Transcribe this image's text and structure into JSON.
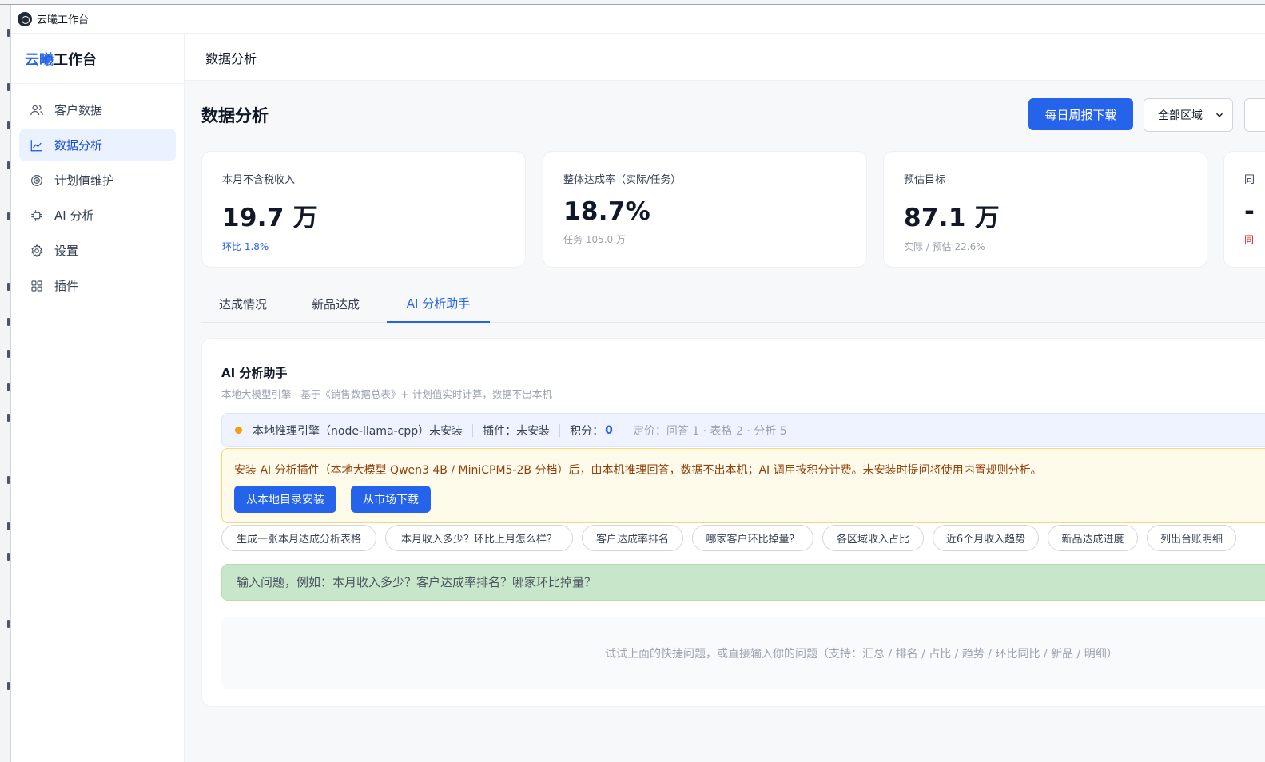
{
  "window": {
    "title": "云曦工作台"
  },
  "brand": {
    "part1": "云曦",
    "part2": "工作台"
  },
  "sidebar": {
    "items": [
      {
        "label": "客户数据",
        "icon": "users-icon"
      },
      {
        "label": "数据分析",
        "icon": "line-chart-icon",
        "active": true
      },
      {
        "label": "计划值维护",
        "icon": "target-icon"
      },
      {
        "label": "AI 分析",
        "icon": "chip-icon"
      },
      {
        "label": "设置",
        "icon": "gear-icon"
      },
      {
        "label": "插件",
        "icon": "grid-icon"
      }
    ]
  },
  "topbar": {
    "title": "数据分析"
  },
  "page": {
    "title": "数据分析",
    "download_button": "每日周报下载",
    "region_select": "全部区域"
  },
  "cards": [
    {
      "label": "本月不含税收入",
      "value": "19.7 万",
      "sub": "环比 1.8%"
    },
    {
      "label": "整体达成率（实际/任务）",
      "value": "18.7%",
      "sub": "任务 105.0 万"
    },
    {
      "label": "预估目标",
      "value": "87.1 万",
      "sub": "实际 / 预估 22.6%"
    },
    {
      "label": "同",
      "value": "-",
      "sub": "同"
    }
  ],
  "tabs": [
    {
      "label": "达成情况"
    },
    {
      "label": "新品达成"
    },
    {
      "label": "AI 分析助手",
      "active": true
    }
  ],
  "ai_panel": {
    "title": "AI 分析助手",
    "subtitle": "本地大模型引擎 · 基于《销售数据总表》+ 计划值实时计算，数据不出本机",
    "status": {
      "engine": "本地推理引擎（node-llama-cpp）未安装",
      "plugin": "插件：未安装",
      "points_label": "积分：",
      "points_value": "0",
      "pricing": "定价：问答 1 · 表格 2 · 分析 5"
    },
    "warning": {
      "text": "安装 AI 分析插件（本地大模型 Qwen3 4B / MiniCPM5-2B 分档）后，由本机推理回答，数据不出本机；AI 调用按积分计费。未安装时提问将使用内置规则分析。",
      "install_local": "从本地目录安装",
      "download_market": "从市场下载"
    },
    "quick_questions": [
      "生成一张本月达成分析表格",
      "本月收入多少？环比上月怎么样？",
      "客户达成率排名",
      "哪家客户环比掉量？",
      "各区域收入占比",
      "近6个月收入趋势",
      "新品达成进度",
      "列出台账明细"
    ],
    "input_placeholder": "输入问题，例如：本月收入多少？客户达成率排名？哪家环比掉量？",
    "empty_hint": "试试上面的快捷问题，或直接输入你的问题（支持：汇总 / 排名 / 占比 / 趋势 / 环比同比 / 新品 / 明细）"
  },
  "colors": {
    "accent": "#2563eb",
    "active_nav_bg": "#eaf1ff",
    "warning_bg": "#fffbea",
    "warning_text": "#92400e",
    "input_bg": "#c8e6c9",
    "status_dot": "#f59e0b"
  }
}
